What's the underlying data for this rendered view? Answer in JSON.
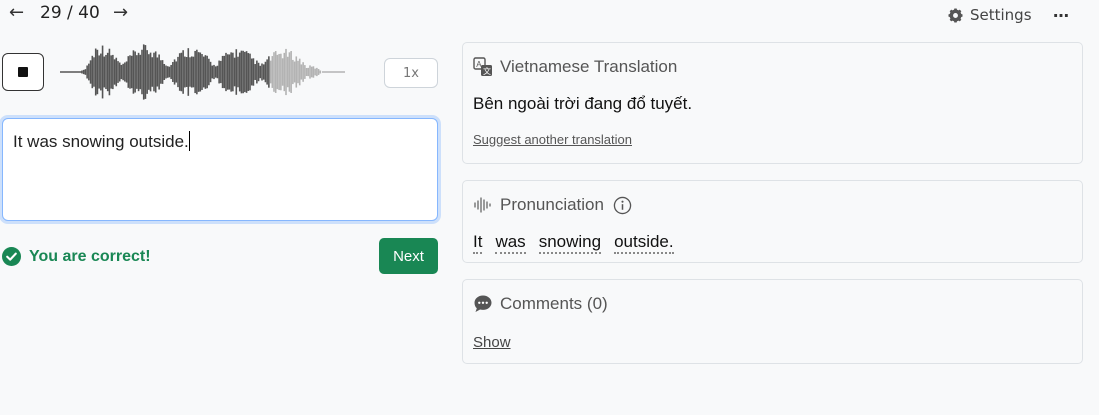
{
  "nav": {
    "prev_icon": "arrow-left-icon",
    "next_icon": "arrow-right-icon",
    "counter": "29 / 40"
  },
  "header": {
    "settings_label": "Settings",
    "settings_icon": "gear-icon",
    "more_label": "…",
    "more_icon": "more-horizontal-icon"
  },
  "player": {
    "stop_icon": "stop-icon",
    "speed_label": "1x",
    "played_fraction": 0.78,
    "colors": {
      "played": "#555555",
      "unplayed": "#b3b3b3"
    }
  },
  "answer": {
    "text": "It was snowing outside."
  },
  "feedback": {
    "message": "You are correct!",
    "icon": "check-circle-icon",
    "color": "#198754"
  },
  "next_button": {
    "label": "Next"
  },
  "translation": {
    "icon": "translate-icon",
    "title": "Vietnamese Translation",
    "text": "Bên ngoài trời đang đổ tuyết.",
    "suggest_link": "Suggest another translation"
  },
  "pronunciation": {
    "icon": "audio-wave-icon",
    "title": "Pronunciation",
    "info_icon": "info-icon",
    "words": [
      "It",
      "was",
      "snowing",
      "outside."
    ]
  },
  "comments": {
    "icon": "chat-bubble-icon",
    "title": "Comments (0)",
    "show_link": "Show"
  }
}
